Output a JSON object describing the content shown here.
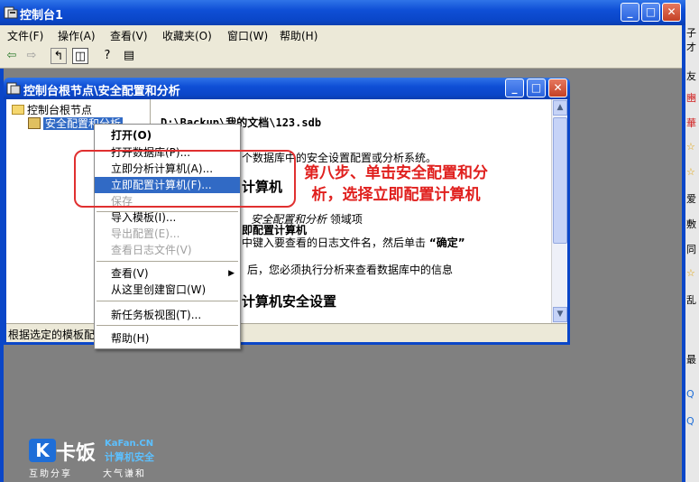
{
  "app": {
    "title": "控制台1",
    "controls": {
      "minimize": "_",
      "maximize": "□",
      "close": "✕"
    }
  },
  "menu": [
    "文件(F)",
    "操作(A)",
    "查看(V)",
    "收藏夹(O)",
    "窗口(W)",
    "帮助(H)"
  ],
  "toolbar_icons": [
    "back-icon",
    "forward-icon",
    "up-folder-icon",
    "show-tree-icon",
    "properties-icon",
    "help-pane-icon"
  ],
  "inner_window": {
    "title": "控制台根节点\\安全配置和分析"
  },
  "tree": {
    "root": "控制台根节点",
    "child": "安全配置和分析"
  },
  "content": {
    "db_path": "D:\\Backup\\我的文档\\123.sdb",
    "line1": "个数据库中的安全设置配置或分析系统。",
    "heading1": "计算机",
    "line2_italic": "安全配置和分析",
    "line2_rest": "领域项",
    "subheading": "即配置计算机",
    "line3": "中键入要查看的日志文件名，然后单击",
    "line3_bold": "“确定”",
    "line4": "后，您必须执行分析来查看数据库中的信息",
    "heading2": "计算机安全设置"
  },
  "status_text": "根据选定的模板配",
  "context_menu": {
    "open": "打开(O)",
    "open_db": "打开数据库(P)...",
    "analyze_now": "立即分析计算机(A)...",
    "configure_now": "立即配置计算机(F)...",
    "save": "保存",
    "import_template": "导入模板(I)...",
    "export_template": "导出配置(E)...",
    "view_log": "查看日志文件(V)",
    "view": "查看(V)",
    "new_window": "从这里创建窗口(W)",
    "new_taskpad": "新任务板视图(T)...",
    "help": "帮助(H)"
  },
  "annotation": "第八步、单击安全配置和分析，选择立即配置计算机",
  "right_strip": [
    "子才",
    "友",
    "豳",
    "華",
    "☆",
    "☆",
    "爱",
    "敷",
    "同",
    "☆",
    "乱",
    "最",
    "Q",
    "Q"
  ],
  "logo": {
    "mark": "K",
    "name": "卡饭",
    "en": "KaFan.CN",
    "cn": "计算机安全",
    "tag1": "互助分享",
    "tag2": "大气谦和"
  }
}
